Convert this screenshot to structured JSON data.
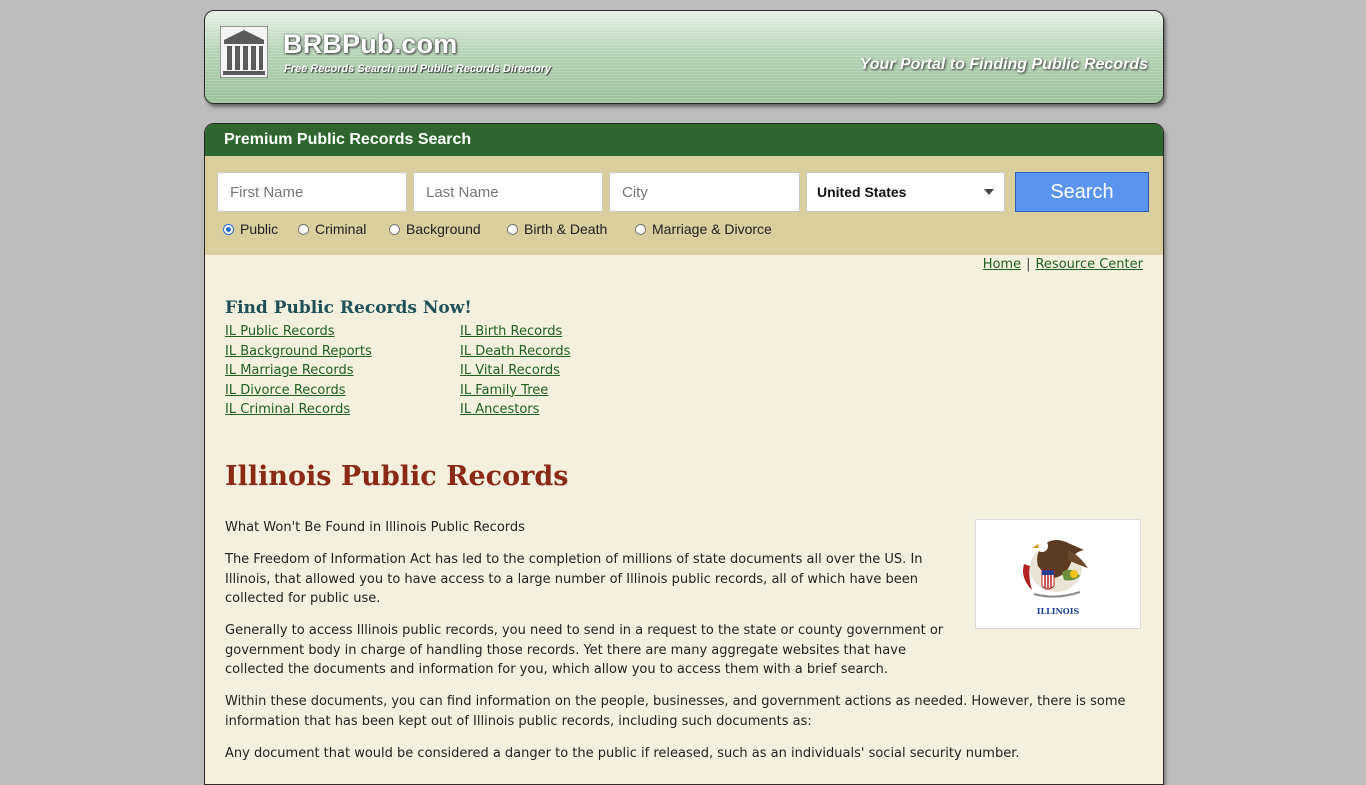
{
  "header": {
    "site_name": "BRBPub.com",
    "subtitle": "Free Records Search and Public Records Directory",
    "tagline": "Your Portal to Finding Public Records"
  },
  "search": {
    "title": "Premium Public Records Search",
    "first_name_placeholder": "First Name",
    "last_name_placeholder": "Last Name",
    "city_placeholder": "City",
    "country_selected": "United States",
    "button_label": "Search",
    "record_types": [
      {
        "label": "Public",
        "checked": true
      },
      {
        "label": "Criminal",
        "checked": false
      },
      {
        "label": "Background",
        "checked": false
      },
      {
        "label": "Birth & Death",
        "checked": false
      },
      {
        "label": "Marriage & Divorce",
        "checked": false
      }
    ]
  },
  "nav": {
    "home": "Home",
    "separator": "|",
    "resource_center": "Resource Center"
  },
  "find_records": {
    "title": "Find Public Records Now!",
    "col1": [
      "IL Public Records",
      "IL Background Reports",
      "IL Marriage Records",
      "IL Divorce Records",
      "IL Criminal Records"
    ],
    "col2": [
      "IL Birth Records",
      "IL Death Records",
      "IL Vital Records",
      "IL Family Tree",
      "IL Ancestors"
    ]
  },
  "article": {
    "title": "Illinois Public Records",
    "flag_label": "ILLINOIS",
    "paragraphs": [
      "What Won't Be Found in Illinois Public Records",
      "The Freedom of Information Act has led to the completion of millions of state documents all over the US. In Illinois, that allowed you to have access to a large number of Illinois public records, all of which have been collected for public use.",
      "Generally to access Illinois public records, you need to send in a request to the state or county government or government body in charge of handling those records. Yet there are many aggregate websites that have collected the documents and information for you, which allow you to access them with a brief search.",
      "Within these documents, you can find information on the people, businesses, and government actions as needed. However, there is some information that has been kept out of Illinois public records, including such documents as:",
      "Any document that would be considered a danger to the public if released, such as an individuals' social security number."
    ]
  },
  "colors": {
    "header_green": "#9cc09c",
    "bar_green": "#2f6630",
    "search_band": "#d8cf9c",
    "content_bg": "#f3f0e0",
    "link_green": "#1f5f1f",
    "title_red": "#8b2a14",
    "button_blue": "#5b93f0"
  }
}
